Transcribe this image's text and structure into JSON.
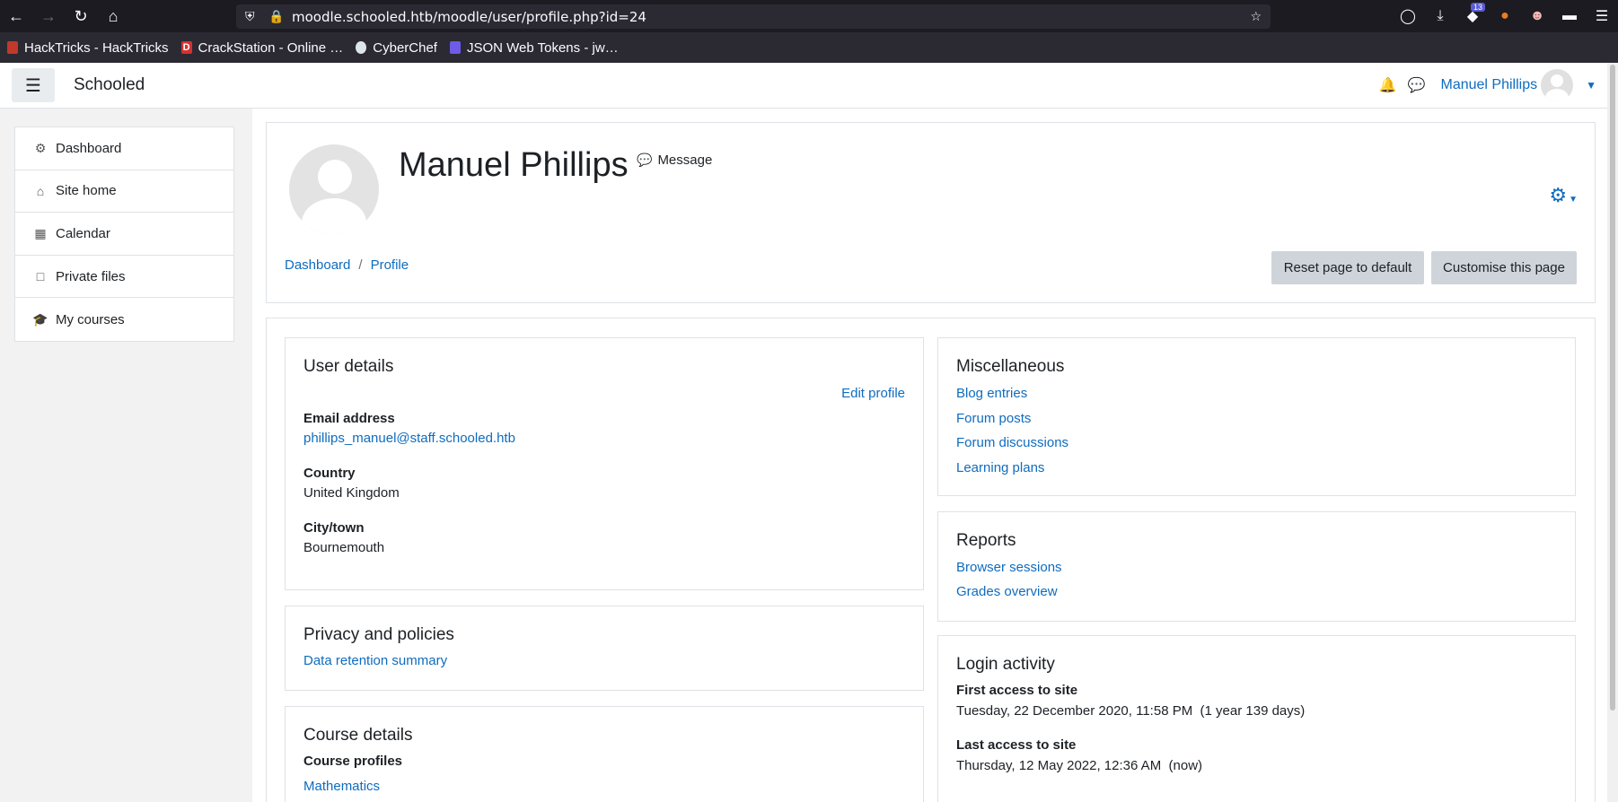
{
  "browser": {
    "url": "moodle.schooled.htb/moodle/user/profile.php?id=24",
    "extensions_badge": "13",
    "bookmarks": [
      {
        "label": "HackTricks - HackTricks",
        "icon": "hacktricks-icon",
        "color": "#c0392b"
      },
      {
        "label": "CrackStation - Online …",
        "icon": "crackstation-icon",
        "color": "#d63031"
      },
      {
        "label": "CyberChef",
        "icon": "cyberchef-icon",
        "color": "#dfe6e9"
      },
      {
        "label": "JSON Web Tokens - jw…",
        "icon": "jwt-icon",
        "color": "#a29bfe"
      }
    ]
  },
  "navbar": {
    "brand": "Schooled",
    "user_name": "Manuel Phillips"
  },
  "sidebar": {
    "items": [
      {
        "label": "Dashboard",
        "icon": "dashboard-icon"
      },
      {
        "label": "Site home",
        "icon": "home-icon"
      },
      {
        "label": "Calendar",
        "icon": "calendar-icon"
      },
      {
        "label": "Private files",
        "icon": "file-icon"
      },
      {
        "label": "My courses",
        "icon": "graduation-cap-icon"
      }
    ]
  },
  "header": {
    "name": "Manuel Phillips",
    "message_label": "Message",
    "breadcrumb": [
      "Dashboard",
      "Profile"
    ],
    "reset_label": "Reset page to default",
    "customise_label": "Customise this page"
  },
  "user_details": {
    "title": "User details",
    "edit_label": "Edit profile",
    "email_label": "Email address",
    "email_value": "phillips_manuel@staff.schooled.htb",
    "country_label": "Country",
    "country_value": "United Kingdom",
    "city_label": "City/town",
    "city_value": "Bournemouth"
  },
  "privacy": {
    "title": "Privacy and policies",
    "link": "Data retention summary"
  },
  "course_details": {
    "title": "Course details",
    "subtitle": "Course profiles",
    "course": "Mathematics"
  },
  "misc": {
    "title": "Miscellaneous",
    "links": [
      "Blog entries",
      "Forum posts",
      "Forum discussions",
      "Learning plans"
    ]
  },
  "reports": {
    "title": "Reports",
    "links": [
      "Browser sessions",
      "Grades overview"
    ]
  },
  "login": {
    "title": "Login activity",
    "first_label": "First access to site",
    "first_value": "Tuesday, 22 December 2020, 11:58 PM  (1 year 139 days)",
    "last_label": "Last access to site",
    "last_value": "Thursday, 12 May 2022, 12:36 AM  (now)"
  }
}
